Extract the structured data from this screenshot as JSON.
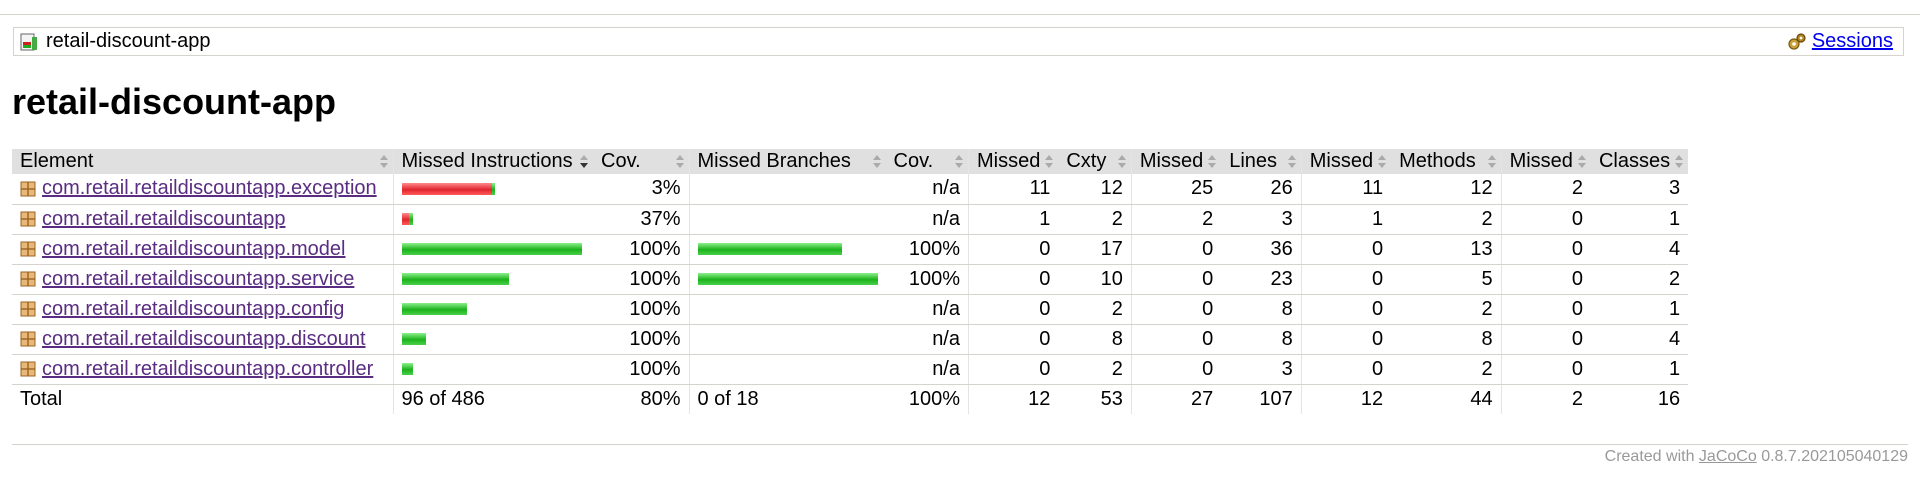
{
  "breadcrumb": {
    "report_name": "retail-discount-app",
    "sessions_label": "Sessions",
    "icon": "report-icon",
    "sessions_icon": "session-gear-icon"
  },
  "page_title": "retail-discount-app",
  "table": {
    "headers": {
      "element": "Element",
      "missed_instructions": "Missed Instructions",
      "cov_instructions": "Cov.",
      "missed_branches": "Missed Branches",
      "cov_branches": "Cov.",
      "missed_cxty": "Missed",
      "cxty": "Cxty",
      "missed_lines": "Missed",
      "lines": "Lines",
      "missed_methods": "Missed",
      "methods": "Methods",
      "missed_classes": "Missed",
      "classes": "Classes"
    },
    "rows": [
      {
        "element": "com.retail.retaildiscountapp.exception",
        "instr_missed_frac": 0.97,
        "instr_total": 66,
        "instr_cov": "3%",
        "branch_total": 0,
        "branch_missed_frac": 0,
        "branch_cov": "n/a",
        "missed_cxty": "11",
        "cxty": "12",
        "missed_lines": "25",
        "lines": "26",
        "missed_methods": "11",
        "methods": "12",
        "missed_classes": "2",
        "classes": "3"
      },
      {
        "element": "com.retail.retaildiscountapp",
        "instr_missed_frac": 0.63,
        "instr_total": 8,
        "instr_cov": "37%",
        "branch_total": 0,
        "branch_missed_frac": 0,
        "branch_cov": "n/a",
        "missed_cxty": "1",
        "cxty": "2",
        "missed_lines": "2",
        "lines": "3",
        "missed_methods": "1",
        "methods": "2",
        "missed_classes": "0",
        "classes": "1"
      },
      {
        "element": "com.retail.retaildiscountapp.model",
        "instr_missed_frac": 0,
        "instr_total": 128,
        "instr_cov": "100%",
        "branch_total": 8,
        "branch_missed_frac": 0,
        "branch_cov": "100%",
        "missed_cxty": "0",
        "cxty": "17",
        "missed_lines": "0",
        "lines": "36",
        "missed_methods": "0",
        "methods": "13",
        "missed_classes": "0",
        "classes": "4"
      },
      {
        "element": "com.retail.retaildiscountapp.service",
        "instr_missed_frac": 0,
        "instr_total": 76,
        "instr_cov": "100%",
        "branch_total": 10,
        "branch_missed_frac": 0,
        "branch_cov": "100%",
        "missed_cxty": "0",
        "cxty": "10",
        "missed_lines": "0",
        "lines": "23",
        "missed_methods": "0",
        "methods": "5",
        "missed_classes": "0",
        "classes": "2"
      },
      {
        "element": "com.retail.retaildiscountapp.config",
        "instr_missed_frac": 0,
        "instr_total": 46,
        "instr_cov": "100%",
        "branch_total": 0,
        "branch_missed_frac": 0,
        "branch_cov": "n/a",
        "missed_cxty": "0",
        "cxty": "2",
        "missed_lines": "0",
        "lines": "8",
        "missed_methods": "0",
        "methods": "2",
        "missed_classes": "0",
        "classes": "1"
      },
      {
        "element": "com.retail.retaildiscountapp.discount",
        "instr_missed_frac": 0,
        "instr_total": 17,
        "instr_cov": "100%",
        "branch_total": 0,
        "branch_missed_frac": 0,
        "branch_cov": "n/a",
        "missed_cxty": "0",
        "cxty": "8",
        "missed_lines": "0",
        "lines": "8",
        "missed_methods": "0",
        "methods": "8",
        "missed_classes": "0",
        "classes": "4"
      },
      {
        "element": "com.retail.retaildiscountapp.controller",
        "instr_missed_frac": 0,
        "instr_total": 8,
        "instr_cov": "100%",
        "branch_total": 0,
        "branch_missed_frac": 0,
        "branch_cov": "n/a",
        "missed_cxty": "0",
        "cxty": "2",
        "missed_lines": "0",
        "lines": "3",
        "missed_methods": "0",
        "methods": "2",
        "missed_classes": "0",
        "classes": "1"
      }
    ],
    "total": {
      "label": "Total",
      "instructions": "96 of 486",
      "instr_cov": "80%",
      "branches": "0 of 18",
      "branch_cov": "100%",
      "missed_cxty": "12",
      "cxty": "53",
      "missed_lines": "27",
      "lines": "107",
      "missed_methods": "12",
      "methods": "44",
      "missed_classes": "2",
      "classes": "16"
    }
  },
  "footer": {
    "created_with": "Created with",
    "tool_name": "JaCoCo",
    "version": "0.8.7.202105040129"
  },
  "colors": {
    "missed": "#e0242e",
    "covered": "#1cb21c",
    "link_visited": "#5a2d82",
    "header_bg": "#e0e0e0"
  }
}
